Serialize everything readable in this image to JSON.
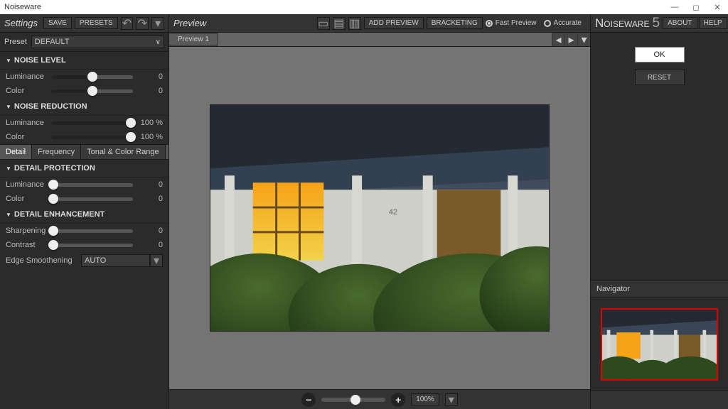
{
  "window_title": "Noiseware",
  "left": {
    "title": "Settings",
    "save": "SAVE",
    "presets": "PRESETS",
    "preset_label": "Preset",
    "preset_value": "DEFAULT",
    "sections": {
      "noise_level": {
        "title": "NOISE LEVEL",
        "luminance": {
          "label": "Luminance",
          "value": "0",
          "pos": 50
        },
        "color": {
          "label": "Color",
          "value": "0",
          "pos": 50
        }
      },
      "noise_reduction": {
        "title": "NOISE REDUCTION",
        "luminance": {
          "label": "Luminance",
          "value": "100",
          "unit": "%",
          "pos": 100
        },
        "color": {
          "label": "Color",
          "value": "100",
          "unit": "%",
          "pos": 100
        }
      },
      "tabs": {
        "detail": "Detail",
        "frequency": "Frequency",
        "tonal": "Tonal & Color Range"
      },
      "detail_protection": {
        "title": "DETAIL PROTECTION",
        "luminance": {
          "label": "Luminance",
          "value": "0",
          "pos": 3
        },
        "color": {
          "label": "Color",
          "value": "0",
          "pos": 3
        }
      },
      "detail_enhancement": {
        "title": "DETAIL ENHANCEMENT",
        "sharpening": {
          "label": "Sharpening",
          "value": "0",
          "pos": 3
        },
        "contrast": {
          "label": "Contrast",
          "value": "0",
          "pos": 3
        },
        "edge_label": "Edge Smoothening",
        "edge_value": "AUTO"
      }
    }
  },
  "mid": {
    "title": "Preview",
    "add_preview": "ADD PREVIEW",
    "bracketing": "BRACKETING",
    "fast": "Fast Preview",
    "accurate": "Accurate",
    "tab1": "Preview 1",
    "zoom_value": "100%"
  },
  "right": {
    "brand": "Noiseware",
    "version": "5",
    "about": "ABOUT",
    "help": "HELP",
    "ok": "OK",
    "reset": "RESET",
    "navigator": "Navigator"
  }
}
